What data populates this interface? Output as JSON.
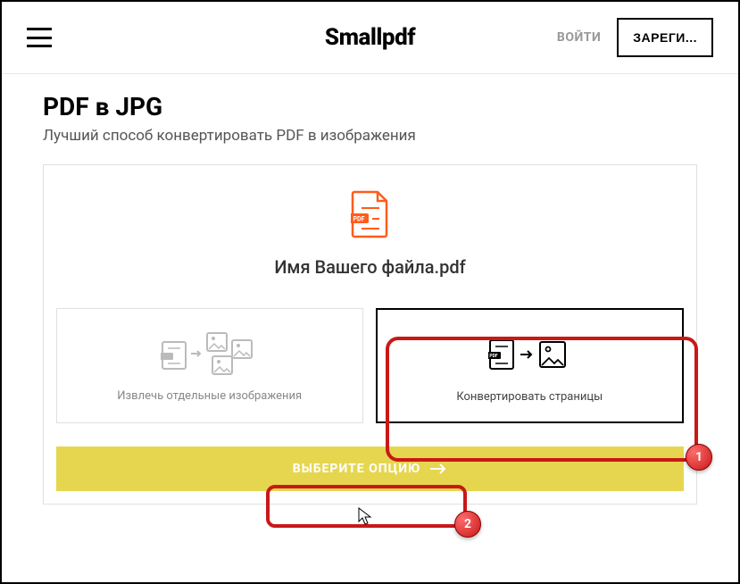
{
  "header": {
    "logo": "Smallpdf",
    "login": "ВОЙТИ",
    "signup": "ЗАРЕГИ..."
  },
  "page": {
    "title": "PDF в JPG",
    "subtitle": "Лучший способ конвертировать PDF в изображения"
  },
  "file": {
    "name": "Имя Вашего файла.pdf"
  },
  "options": [
    {
      "label": "Извлечь отдельные изображения"
    },
    {
      "label": "Конвертировать страницы"
    }
  ],
  "cta": {
    "label": "ВЫБЕРИТЕ ОПЦИЮ"
  },
  "annotations": {
    "badge1": "1",
    "badge2": "2"
  }
}
